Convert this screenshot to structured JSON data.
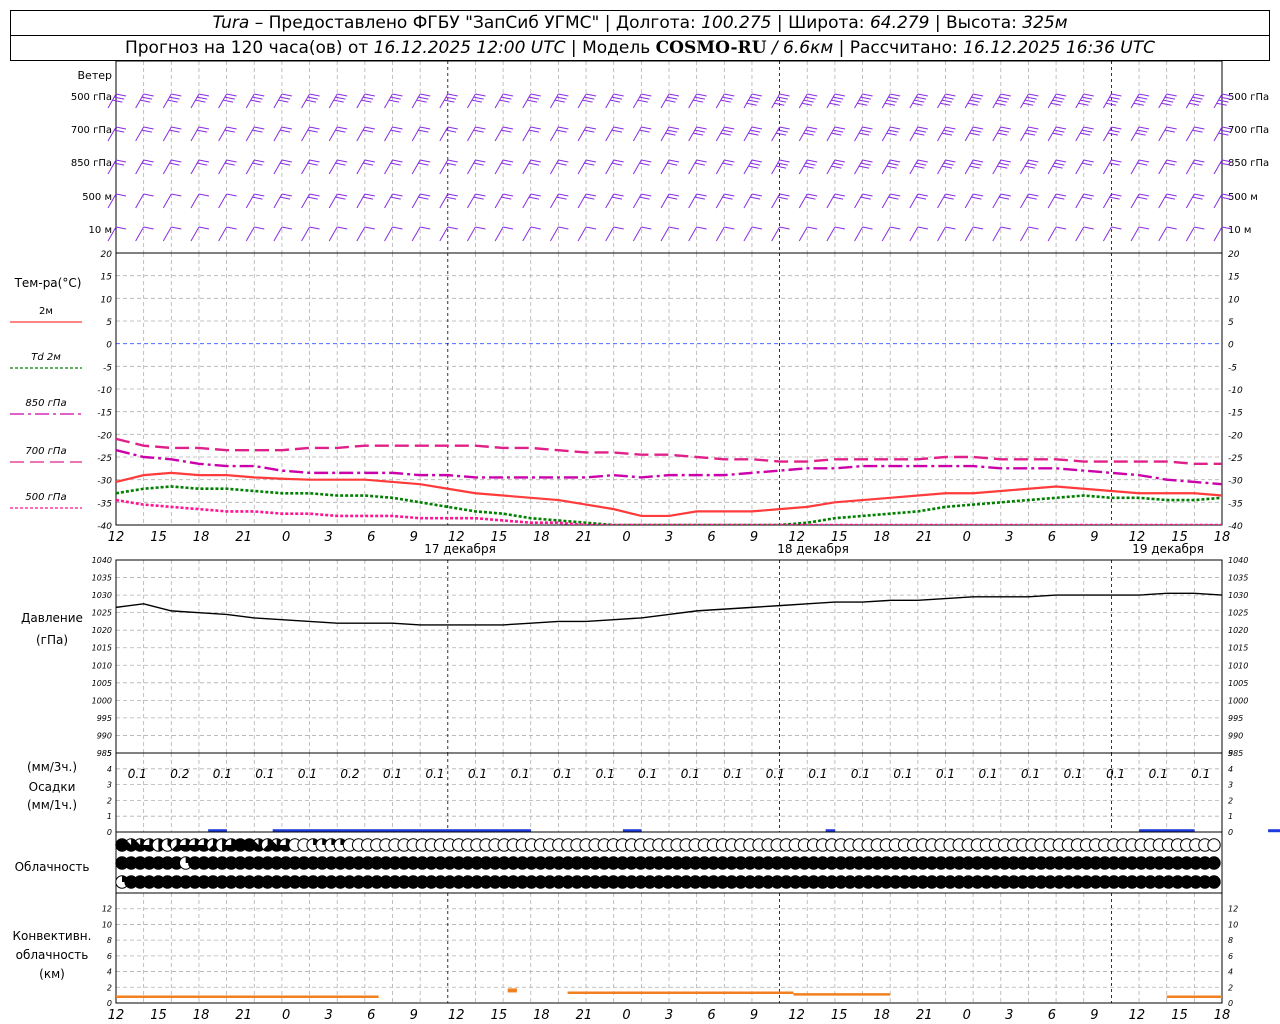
{
  "header": {
    "station": "Tura",
    "provider": "– Предоставлено ФГБУ \"ЗапСиб УГМС\"",
    "lon_label": "Долгота:",
    "lon": "100.275",
    "lat_label": "Широта:",
    "lat": "64.279",
    "alt_label": "Высота:",
    "alt": "325м",
    "forecast_prefix": "Прогноз на 120 часа(ов) от",
    "forecast_time": "16.12.2025 12:00 UTC",
    "model_label": "Модель",
    "model": "COSMO-RU",
    "model_res": "/ 6.6км",
    "calc_label": "Рассчитано:",
    "calc_time": "16.12.2025 16:36 UTC"
  },
  "colors": {
    "t2m": "#ff3b3b",
    "td2m": "#008000",
    "t850": "#cc00aa",
    "t700": "#e0208a",
    "t500": "#ff1493",
    "wind": "#8a2be2",
    "precip": "#1e3cdc",
    "convective": "#f08020",
    "pressure": "#000000",
    "grid": "#b0b0b0",
    "zero_line": "#3355ff"
  },
  "chart_data": [
    {
      "type": "barbs",
      "name": "wind",
      "ylabel": "Ветер",
      "levels": [
        "500 гПа",
        "700 гПа",
        "850 гПа",
        "500 м",
        "10  м"
      ],
      "speed_by_level": [
        [
          25,
          28,
          30,
          30,
          32,
          30,
          28,
          28,
          30,
          35,
          45,
          45,
          50,
          45,
          40,
          35,
          35
        ],
        [
          20,
          22,
          22,
          22,
          22,
          22,
          20,
          22,
          25,
          30,
          30,
          30,
          32,
          30,
          25,
          20,
          25
        ],
        [
          15,
          18,
          18,
          18,
          18,
          18,
          20,
          20,
          22,
          25,
          25,
          25,
          25,
          25,
          22,
          18,
          20
        ],
        [
          12,
          14,
          15,
          15,
          15,
          15,
          15,
          15,
          18,
          20,
          20,
          20,
          20,
          20,
          18,
          15,
          15
        ],
        [
          5,
          5,
          5,
          5,
          5,
          5,
          5,
          5,
          5,
          5,
          5,
          5,
          5,
          5,
          5,
          5,
          5
        ]
      ]
    },
    {
      "type": "line",
      "name": "temperature",
      "ylabel": "Тем-ра(°С)",
      "ylim": [
        -40,
        20
      ],
      "yticks": [
        20,
        15,
        10,
        5,
        0,
        -5,
        -10,
        -15,
        -20,
        -25,
        -30,
        -35,
        -40
      ],
      "legend": [
        "2м",
        "Td  2м",
        "850 гПа",
        "700 гПа",
        "500 гПа"
      ],
      "x_hours": [
        0,
        3,
        6,
        9,
        12,
        15,
        18,
        21,
        24,
        27,
        30,
        33,
        36,
        39,
        42,
        45,
        48,
        51,
        54,
        57,
        60,
        63,
        66,
        69,
        72,
        75,
        78,
        81,
        84,
        87,
        90,
        93,
        96,
        99,
        102,
        105,
        108,
        111,
        114,
        117,
        120
      ],
      "series": [
        {
          "name": "2м",
          "key": "t2m",
          "values": [
            -30.5,
            -29,
            -28.5,
            -29,
            -29,
            -29.5,
            -29.8,
            -30,
            -30,
            -30,
            -30.5,
            -31,
            -32,
            -33,
            -33.5,
            -34,
            -34.5,
            -35.5,
            -36.5,
            -38,
            -38,
            -37,
            -37,
            -37,
            -36.5,
            -36,
            -35,
            -34.5,
            -34,
            -33.5,
            -33,
            -33,
            -32.5,
            -32,
            -31.5,
            -32,
            -32.5,
            -33,
            -33,
            -33,
            -33.5
          ]
        },
        {
          "name": "Td  2м",
          "key": "td2m",
          "values": [
            -33,
            -32,
            -31.5,
            -32,
            -32,
            -32.5,
            -33,
            -33,
            -33.5,
            -33.5,
            -34,
            -35,
            -36,
            -37,
            -37.5,
            -38.5,
            -39,
            -39.5,
            -40,
            -40.5,
            -41,
            -41,
            -40.5,
            -40,
            -40,
            -39.5,
            -38.5,
            -38,
            -37.5,
            -37,
            -36,
            -35.5,
            -35,
            -34.5,
            -34,
            -33.5,
            -34,
            -34,
            -34.5,
            -34.5,
            -34
          ]
        },
        {
          "name": "850 гПа",
          "key": "t850",
          "values": [
            -23.5,
            -25,
            -25.5,
            -26.5,
            -27,
            -27,
            -28,
            -28.5,
            -28.5,
            -28.5,
            -28.5,
            -29,
            -29,
            -29.5,
            -29.5,
            -29.5,
            -29.5,
            -29.5,
            -29,
            -29.5,
            -29,
            -29,
            -29,
            -28.5,
            -28,
            -27.5,
            -27.5,
            -27,
            -27,
            -27,
            -27,
            -27,
            -27.5,
            -27.5,
            -27.5,
            -28,
            -28.5,
            -29,
            -30,
            -30.5,
            -31
          ]
        },
        {
          "name": "700 гПа",
          "key": "t700",
          "values": [
            -21,
            -22.5,
            -23,
            -23,
            -23.5,
            -23.5,
            -23.5,
            -23,
            -23,
            -22.5,
            -22.5,
            -22.5,
            -22.5,
            -22.5,
            -23,
            -23,
            -23.5,
            -24,
            -24,
            -24.5,
            -24.5,
            -25,
            -25.5,
            -25.5,
            -26,
            -26,
            -25.5,
            -25.5,
            -25.5,
            -25.5,
            -25,
            -25,
            -25.5,
            -25.5,
            -25.5,
            -26,
            -26,
            -26,
            -26,
            -26.5,
            -26.5
          ]
        },
        {
          "name": "500 гПа",
          "key": "t500",
          "values": [
            -34.5,
            -35.5,
            -36,
            -36.5,
            -37,
            -37,
            -37.5,
            -37.5,
            -38,
            -38,
            -38,
            -38.5,
            -38.5,
            -38.5,
            -39,
            -39.5,
            -39.5,
            -40,
            -40,
            -40,
            -40,
            -40,
            -40.5,
            -41,
            -41,
            -41,
            -41,
            -41,
            -41,
            -41,
            -41,
            -41,
            -41,
            -41,
            -41,
            -41,
            -41,
            -41,
            -41,
            -41,
            -41
          ]
        }
      ],
      "x_tick_labels": [
        "12",
        "15",
        "18",
        "21",
        "0",
        "3",
        "6",
        "9",
        "12",
        "15",
        "18",
        "21",
        "0",
        "3",
        "6",
        "9",
        "12",
        "15",
        "18",
        "21",
        "0",
        "3",
        "6",
        "9",
        "12",
        "15",
        "18"
      ],
      "day_labels": [
        "17 декабря",
        "18 декабря",
        "19 декабря"
      ]
    },
    {
      "type": "line",
      "name": "pressure",
      "ylabel": "Давление",
      "yunit": "(гПа)",
      "ylim": [
        985,
        1040
      ],
      "yticks": [
        1040,
        1035,
        1030,
        1025,
        1020,
        1015,
        1010,
        1005,
        1000,
        995,
        990,
        985
      ],
      "values": [
        1026.5,
        1027.5,
        1025.5,
        1025,
        1024.5,
        1023.5,
        1023,
        1022.5,
        1022,
        1022,
        1022,
        1021.5,
        1021.5,
        1021.5,
        1021.5,
        1022,
        1022.5,
        1022.5,
        1023,
        1023.5,
        1024.5,
        1025.5,
        1026,
        1026.5,
        1027,
        1027.5,
        1028,
        1028,
        1028.5,
        1028.5,
        1029,
        1029.5,
        1029.5,
        1029.5,
        1030,
        1030,
        1030,
        1030,
        1030.5,
        1030.5,
        1030
      ]
    },
    {
      "type": "bar",
      "name": "precipitation",
      "ylabel": "Осадки",
      "unit_top": "(мм/3ч.)",
      "unit_bottom": "(мм/1ч.)",
      "ylim": [
        0,
        5
      ],
      "yticks": [
        5,
        4,
        3,
        2,
        1,
        0
      ],
      "sums_3h": [
        "0.1",
        "0.2",
        "0.1",
        "0.1",
        "0.1",
        "0.2",
        "0.1",
        "0.1",
        "0.1",
        "0.1",
        "0.1",
        "0.1",
        "0.1",
        "0.1",
        "0.1",
        "0.1",
        "0.1",
        "0.1",
        "0.1",
        "0.1",
        "0.1",
        "0.1",
        "0.1",
        "0.1",
        "0.1",
        "0.1"
      ],
      "hourly_values": [
        0,
        0,
        0,
        0,
        0,
        0,
        0,
        0,
        0,
        0,
        0.05,
        0.05,
        0,
        0,
        0,
        0,
        0,
        0.05,
        0.05,
        0.05,
        0.05,
        0.05,
        0.05,
        0.05,
        0.05,
        0.05,
        0.05,
        0.05,
        0.05,
        0.05,
        0.05,
        0.05,
        0.05,
        0.05,
        0.05,
        0.05,
        0.05,
        0.05,
        0.05,
        0.05,
        0.05,
        0.05,
        0.05,
        0.05,
        0.05,
        0,
        0,
        0,
        0,
        0,
        0,
        0,
        0,
        0,
        0,
        0.05,
        0.05,
        0,
        0,
        0,
        0,
        0,
        0,
        0,
        0,
        0,
        0,
        0,
        0,
        0,
        0,
        0,
        0,
        0,
        0,
        0,
        0,
        0.05,
        0,
        0,
        0,
        0,
        0,
        0,
        0,
        0,
        0,
        0,
        0,
        0,
        0,
        0,
        0,
        0,
        0,
        0,
        0,
        0,
        0,
        0,
        0,
        0,
        0,
        0,
        0,
        0,
        0,
        0,
        0,
        0,
        0,
        0.05,
        0.05,
        0.05,
        0.05,
        0.05,
        0.05,
        0,
        0,
        0,
        0,
        0,
        0,
        0,
        0,
        0.05,
        0.05,
        0.05
      ]
    },
    {
      "type": "table",
      "name": "cloudiness",
      "ylabel": "Облачность",
      "rows": [
        [
          8,
          7,
          7,
          6,
          4,
          3,
          5,
          6,
          6,
          6,
          5,
          4,
          6,
          8,
          8,
          7,
          5,
          7,
          6,
          0,
          0,
          2,
          2,
          2,
          2,
          0,
          0,
          0,
          0,
          0,
          0,
          0,
          0,
          0,
          0,
          0,
          0,
          0,
          0,
          0,
          0,
          0,
          0,
          0,
          0,
          0,
          0,
          0,
          0,
          0,
          0,
          0,
          0,
          0,
          0,
          0,
          0,
          0,
          0,
          0,
          0,
          0,
          0,
          0,
          0,
          0,
          0,
          0,
          0,
          0,
          0,
          0,
          0,
          0,
          0,
          0,
          0,
          0,
          0,
          0,
          0,
          0,
          0,
          0,
          0,
          0,
          0,
          0,
          0,
          0,
          0,
          0,
          0,
          0,
          0,
          0,
          0,
          0,
          0,
          0,
          0,
          0,
          0,
          0,
          0,
          0,
          0,
          0,
          0,
          0,
          0,
          0,
          0,
          0,
          0,
          0,
          0,
          0,
          0,
          0,
          0,
          0,
          0
        ],
        [
          8,
          8,
          8,
          8,
          8,
          8,
          8,
          2,
          8,
          8,
          8,
          8,
          8,
          8,
          8,
          8,
          8,
          8,
          8,
          8,
          8,
          8,
          8,
          8,
          8,
          8,
          8,
          8,
          8,
          8,
          8,
          8,
          8,
          8,
          8,
          8,
          8,
          8,
          8,
          8,
          8,
          8,
          8,
          8,
          8,
          8,
          8,
          8,
          8,
          8,
          8,
          8,
          8,
          8,
          8,
          8,
          8,
          8,
          8,
          8,
          8,
          8,
          8,
          8,
          8,
          8,
          8,
          8,
          8,
          8,
          8,
          8,
          8,
          8,
          8,
          8,
          8,
          8,
          8,
          8,
          8,
          8,
          8,
          8,
          8,
          8,
          8,
          8,
          8,
          8,
          8,
          8,
          8,
          8,
          8,
          8,
          8,
          8,
          8,
          8,
          8,
          8,
          8,
          8,
          8,
          8,
          8,
          8,
          8,
          8,
          8,
          8,
          8,
          8,
          8,
          8,
          8,
          8,
          8,
          8,
          8,
          8
        ],
        [
          2,
          8,
          8,
          8,
          8,
          8,
          8,
          8,
          8,
          8,
          8,
          8,
          8,
          8,
          8,
          8,
          8,
          8,
          8,
          8,
          8,
          8,
          8,
          8,
          8,
          8,
          8,
          8,
          8,
          8,
          8,
          8,
          8,
          8,
          8,
          8,
          8,
          8,
          8,
          8,
          8,
          8,
          8,
          8,
          8,
          8,
          8,
          8,
          8,
          8,
          8,
          8,
          8,
          8,
          8,
          8,
          8,
          8,
          8,
          8,
          8,
          8,
          8,
          8,
          8,
          8,
          8,
          8,
          8,
          8,
          8,
          8,
          8,
          8,
          8,
          8,
          8,
          8,
          8,
          8,
          8,
          8,
          8,
          8,
          8,
          8,
          8,
          8,
          8,
          8,
          8,
          8,
          8,
          8,
          8,
          8,
          8,
          8,
          8,
          8,
          8,
          8,
          8,
          8,
          8,
          8,
          8,
          8,
          8,
          8,
          8,
          8,
          8,
          8,
          8,
          8,
          8,
          8,
          8,
          8,
          8,
          8
        ]
      ]
    },
    {
      "type": "bar",
      "name": "convective",
      "ylabel": "Конвективн.",
      "ylabel2": "облачность",
      "yunit": "(км)",
      "ylim": [
        0,
        14
      ],
      "yticks": [
        12,
        10,
        8,
        6,
        4,
        2,
        0
      ],
      "segments": [
        {
          "from_h": 0,
          "to_h": 28.5,
          "km": 0.8
        },
        {
          "from_h": 42.5,
          "to_h": 43.5,
          "km": 1.6
        },
        {
          "from_h": 49,
          "to_h": 73.5,
          "km": 1.3
        },
        {
          "from_h": 73.5,
          "to_h": 84,
          "km": 1.1
        },
        {
          "from_h": 114,
          "to_h": 120,
          "km": 0.8
        }
      ]
    }
  ]
}
